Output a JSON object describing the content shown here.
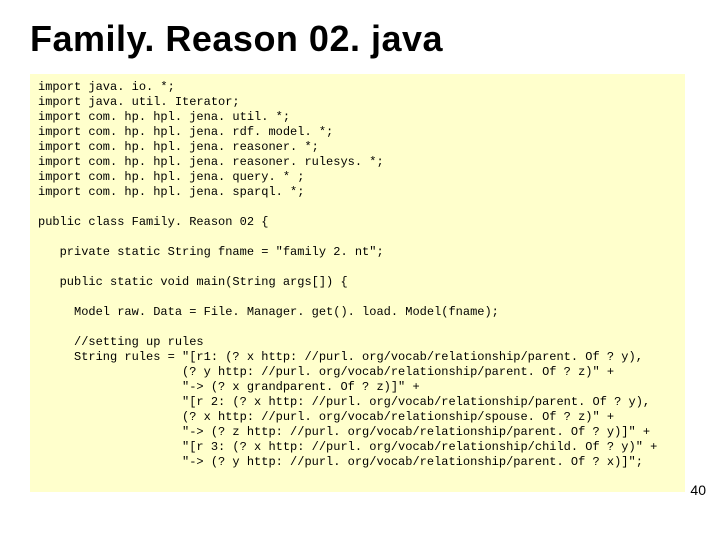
{
  "title": "Family. Reason 02. java",
  "page_number": "40",
  "footer_mark": "",
  "code_lines": [
    "import java. io. *;",
    "import java. util. Iterator;",
    "import com. hp. hpl. jena. util. *;",
    "import com. hp. hpl. jena. rdf. model. *;",
    "import com. hp. hpl. jena. reasoner. *;",
    "import com. hp. hpl. jena. reasoner. rulesys. *;",
    "import com. hp. hpl. jena. query. * ;",
    "import com. hp. hpl. jena. sparql. *;",
    "",
    "public class Family. Reason 02 {",
    "",
    "   private static String fname = \"family 2. nt\";",
    "",
    "   public static void main(String args[]) {",
    "",
    "     Model raw. Data = File. Manager. get(). load. Model(fname);",
    "",
    "     //setting up rules",
    "     String rules = \"[r1: (? x http: //purl. org/vocab/relationship/parent. Of ? y),",
    "                    (? y http: //purl. org/vocab/relationship/parent. Of ? z)\" +",
    "                    \"-> (? x grandparent. Of ? z)]\" +",
    "                    \"[r 2: (? x http: //purl. org/vocab/relationship/parent. Of ? y),",
    "                    (? x http: //purl. org/vocab/relationship/spouse. Of ? z)\" +",
    "                    \"-> (? z http: //purl. org/vocab/relationship/parent. Of ? y)]\" +",
    "                    \"[r 3: (? x http: //purl. org/vocab/relationship/child. Of ? y)\" +",
    "                    \"-> (? y http: //purl. org/vocab/relationship/parent. Of ? x)]\";"
  ]
}
